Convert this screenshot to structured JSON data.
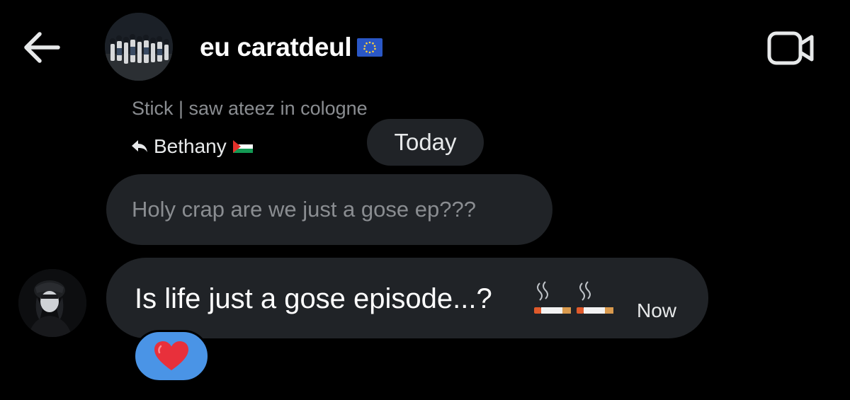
{
  "header": {
    "back_icon": "arrow-left-icon",
    "title": "eu caratdeul",
    "title_flag": "eu-flag-icon",
    "video_icon": "video-camera-icon"
  },
  "reply": {
    "context": "Stick | saw ateez in cologne",
    "author": "Bethany",
    "author_flag": "palestine-flag-icon",
    "arrow_icon": "reply-arrow-icon"
  },
  "date_divider": "Today",
  "quoted_message": {
    "text": "Holy crap are we just a gose ep???"
  },
  "message": {
    "text": "Is life just a gose episode...?",
    "emojis": [
      "cigarette-emoji",
      "cigarette-emoji"
    ],
    "time": "Now"
  },
  "reaction": {
    "emoji": "red-heart-emoji",
    "color": "#4a94e6"
  },
  "colors": {
    "background": "#000000",
    "bubble": "#202327",
    "muted_text": "#8a8d91",
    "text": "#ffffff",
    "reaction_bg": "#4a94e6",
    "heart": "#e8303b"
  }
}
